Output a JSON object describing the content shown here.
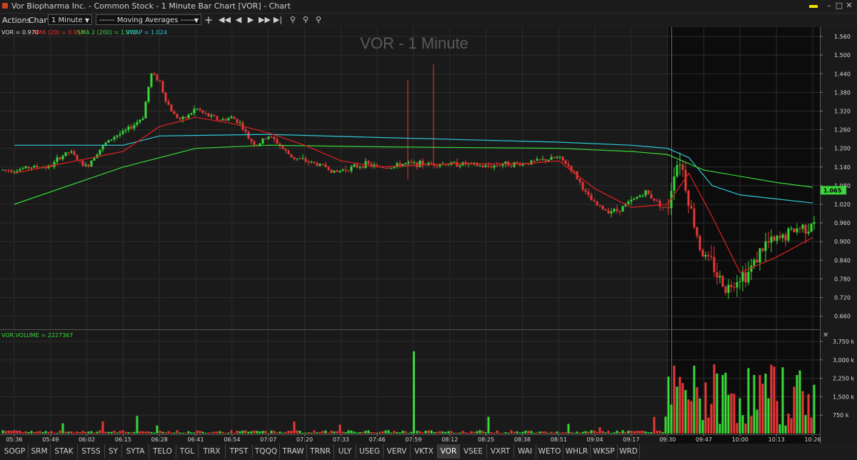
{
  "window": {
    "title": "Vor Biopharma Inc. - Common Stock - 1 Minute Bar Chart [VOR] - Chart",
    "minimize_icon": "minimize-icon",
    "maximize_icon": "maximize-icon",
    "close_icon": "close-icon",
    "badge_color": "#e8e200"
  },
  "toolbar": {
    "actions_label": "Actions",
    "chart_label": "Chart",
    "interval_value": "1 Minute",
    "study_value": "------ Moving Averages ------",
    "icons": [
      "plus-icon",
      "first-icon",
      "prev-icon",
      "next-icon",
      "fast-forward-icon",
      "last-icon",
      "zoom-icon",
      "zoom-in-icon",
      "zoom-out-icon"
    ]
  },
  "chart_data": {
    "type": "candlestick",
    "title": "VOR - 1 Minute",
    "legend": {
      "last": "VOR = 0.970",
      "sma20": "SMA (20) = 0.913",
      "sma200": "SMA 2 (200) = 1.075",
      "vwap": "VWAP = 1.024"
    },
    "colors": {
      "up": "#38d838",
      "down": "#e83838",
      "sma20": "#e02020",
      "sma200": "#38d838",
      "vwap": "#30c8d8",
      "session_bg": "#0c0c0c",
      "bg": "#1a1a1a",
      "grid": "#2c2c2c"
    },
    "price_axis": {
      "ticks": [
        "1.560",
        "1.500",
        "1.440",
        "1.380",
        "1.320",
        "1.260",
        "1.200",
        "1.140",
        "1.080",
        "1.020",
        "0.960",
        "0.900",
        "0.840",
        "0.780",
        "0.720",
        "0.660"
      ],
      "ylim": [
        0.62,
        1.59
      ]
    },
    "current_price_label": "1.065",
    "time_axis": [
      "05:36",
      "05:49",
      "06:02",
      "06:15",
      "06:28",
      "06:41",
      "06:54",
      "07:07",
      "07:20",
      "07:33",
      "07:46",
      "07:59",
      "08:12",
      "08:25",
      "08:38",
      "08:51",
      "09:04",
      "09:17",
      "09:30",
      "09:47",
      "10:00",
      "10:13",
      "10:26"
    ],
    "session_start_time": "09:30",
    "price_series": [
      [
        "05:36",
        1.13
      ],
      [
        "05:42",
        1.14
      ],
      [
        "05:49",
        1.14
      ],
      [
        "05:52",
        1.17
      ],
      [
        "05:56",
        1.19
      ],
      [
        "06:00",
        1.15
      ],
      [
        "06:02",
        1.14
      ],
      [
        "06:05",
        1.18
      ],
      [
        "06:08",
        1.21
      ],
      [
        "06:12",
        1.24
      ],
      [
        "06:15",
        1.25
      ],
      [
        "06:18",
        1.27
      ],
      [
        "06:22",
        1.3
      ],
      [
        "06:25",
        1.44
      ],
      [
        "06:28",
        1.42
      ],
      [
        "06:30",
        1.36
      ],
      [
        "06:33",
        1.31
      ],
      [
        "06:36",
        1.29
      ],
      [
        "06:39",
        1.31
      ],
      [
        "06:41",
        1.33
      ],
      [
        "06:44",
        1.31
      ],
      [
        "06:47",
        1.3
      ],
      [
        "06:50",
        1.29
      ],
      [
        "06:54",
        1.3
      ],
      [
        "06:57",
        1.28
      ],
      [
        "07:00",
        1.23
      ],
      [
        "07:03",
        1.21
      ],
      [
        "07:07",
        1.24
      ],
      [
        "07:10",
        1.22
      ],
      [
        "07:13",
        1.19
      ],
      [
        "07:16",
        1.17
      ],
      [
        "07:20",
        1.16
      ],
      [
        "07:24",
        1.15
      ],
      [
        "07:28",
        1.14
      ],
      [
        "07:31",
        1.12
      ],
      [
        "07:33",
        1.13
      ],
      [
        "07:38",
        1.14
      ],
      [
        "07:42",
        1.15
      ],
      [
        "07:46",
        1.14
      ],
      [
        "07:52",
        1.14
      ],
      [
        "07:55",
        1.15
      ],
      [
        "07:59",
        1.15
      ],
      [
        "08:04",
        1.15
      ],
      [
        "08:08",
        1.15
      ],
      [
        "08:12",
        1.15
      ],
      [
        "08:18",
        1.15
      ],
      [
        "08:25",
        1.14
      ],
      [
        "08:31",
        1.15
      ],
      [
        "08:38",
        1.15
      ],
      [
        "08:44",
        1.16
      ],
      [
        "08:51",
        1.17
      ],
      [
        "08:55",
        1.14
      ],
      [
        "08:58",
        1.1
      ],
      [
        "09:01",
        1.05
      ],
      [
        "09:04",
        1.02
      ],
      [
        "09:08",
        1.0
      ],
      [
        "09:12",
        1.0
      ],
      [
        "09:17",
        1.03
      ],
      [
        "09:22",
        1.06
      ],
      [
        "09:26",
        1.03
      ],
      [
        "09:30",
        1.0
      ],
      [
        "09:33",
        1.13
      ],
      [
        "09:36",
        1.17
      ],
      [
        "09:39",
        1.06
      ],
      [
        "09:42",
        0.97
      ],
      [
        "09:45",
        0.89
      ],
      [
        "09:47",
        0.85
      ],
      [
        "09:50",
        0.83
      ],
      [
        "09:53",
        0.77
      ],
      [
        "09:56",
        0.75
      ],
      [
        "09:58",
        0.78
      ],
      [
        "10:00",
        0.79
      ],
      [
        "10:03",
        0.8
      ],
      [
        "10:06",
        0.85
      ],
      [
        "10:09",
        0.89
      ],
      [
        "10:13",
        0.9
      ],
      [
        "10:16",
        0.92
      ],
      [
        "10:20",
        0.94
      ],
      [
        "10:24",
        0.95
      ],
      [
        "10:26",
        0.97
      ]
    ],
    "sma20": [
      [
        "05:36",
        1.12
      ],
      [
        "06:15",
        1.19
      ],
      [
        "06:28",
        1.27
      ],
      [
        "06:41",
        1.3
      ],
      [
        "06:54",
        1.28
      ],
      [
        "07:07",
        1.25
      ],
      [
        "07:20",
        1.21
      ],
      [
        "07:33",
        1.16
      ],
      [
        "07:46",
        1.14
      ],
      [
        "08:12",
        1.15
      ],
      [
        "08:38",
        1.15
      ],
      [
        "08:51",
        1.16
      ],
      [
        "09:04",
        1.07
      ],
      [
        "09:17",
        1.01
      ],
      [
        "09:30",
        1.02
      ],
      [
        "09:40",
        1.12
      ],
      [
        "09:50",
        0.98
      ],
      [
        "10:00",
        0.8
      ],
      [
        "10:13",
        0.85
      ],
      [
        "10:26",
        0.913
      ]
    ],
    "sma200": [
      [
        "05:36",
        1.02
      ],
      [
        "06:15",
        1.14
      ],
      [
        "06:41",
        1.2
      ],
      [
        "07:07",
        1.21
      ],
      [
        "07:46",
        1.205
      ],
      [
        "08:51",
        1.2
      ],
      [
        "09:17",
        1.19
      ],
      [
        "09:30",
        1.18
      ],
      [
        "09:47",
        1.13
      ],
      [
        "10:13",
        1.09
      ],
      [
        "10:26",
        1.075
      ]
    ],
    "vwap": [
      [
        "05:36",
        1.21
      ],
      [
        "06:15",
        1.21
      ],
      [
        "06:28",
        1.24
      ],
      [
        "07:07",
        1.245
      ],
      [
        "07:46",
        1.235
      ],
      [
        "08:51",
        1.22
      ],
      [
        "09:17",
        1.21
      ],
      [
        "09:30",
        1.2
      ],
      [
        "09:40",
        1.17
      ],
      [
        "09:50",
        1.08
      ],
      [
        "10:00",
        1.05
      ],
      [
        "10:26",
        1.024
      ]
    ],
    "volume": {
      "label": "VOR.VOLUME = 2227367",
      "ticks": [
        "3,750 k",
        "3,000 k",
        "2,250 k",
        "1,500 k",
        "750 k"
      ],
      "ylim": [
        0,
        4100000
      ],
      "spike": [
        "07:59",
        3350000
      ]
    }
  },
  "tabs": [
    "SOGP",
    "SRM",
    "STAK",
    "STSS",
    "SY",
    "SYTA",
    "TELO",
    "TGL",
    "TIRX",
    "TPST",
    "TQQQ",
    "TRAW",
    "TRNR",
    "ULY",
    "USEG",
    "VERV",
    "VKTX",
    "VOR",
    "VSEE",
    "VXRT",
    "WAI",
    "WETO",
    "WHLR",
    "WKSP",
    "WRD"
  ],
  "active_tab": "VOR"
}
